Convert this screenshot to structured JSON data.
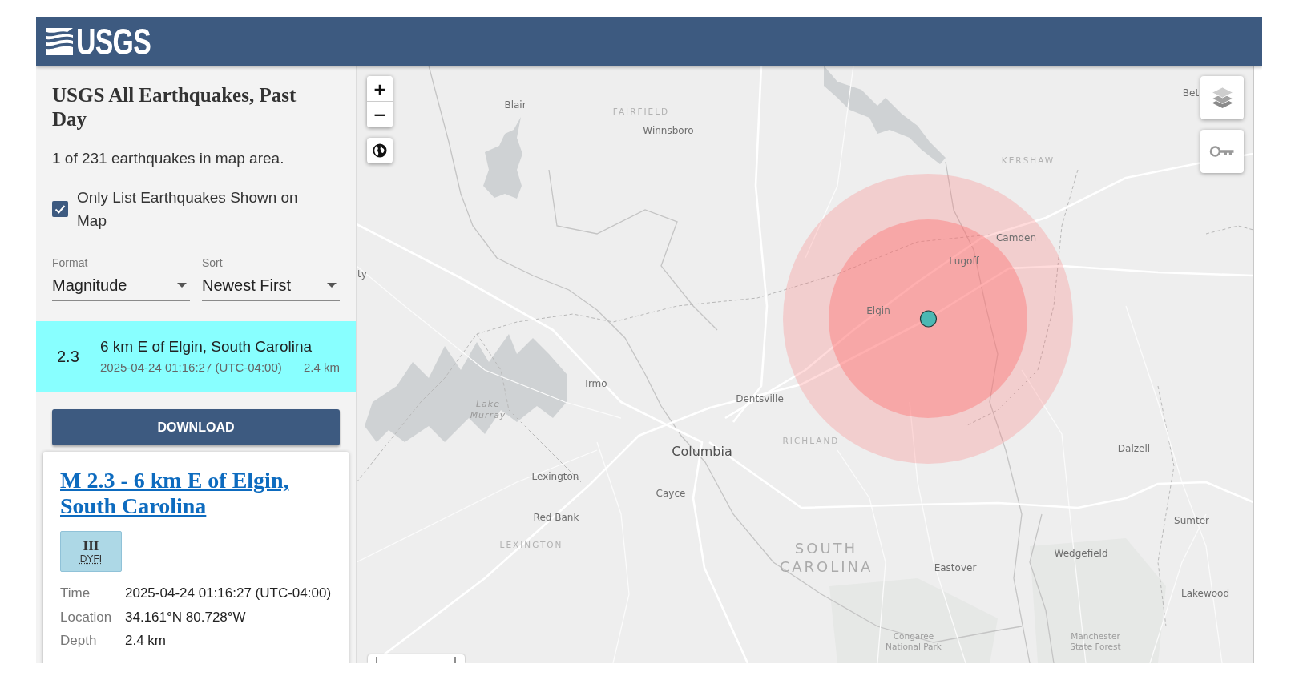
{
  "header": {
    "logo_text": "USGS"
  },
  "sidebar": {
    "title": "USGS All Earthquakes, Past Day",
    "count_text": "1 of 231 earthquakes in map area.",
    "filter_checkbox": {
      "label": "Only List Earthquakes Shown on Map",
      "checked": true
    },
    "selects": [
      {
        "label": "Format",
        "value": "Magnitude"
      },
      {
        "label": "Sort",
        "value": "Newest First"
      }
    ],
    "earthquakes": [
      {
        "magnitude": "2.3",
        "place": "6 km E of Elgin, South Carolina",
        "time": "2025-04-24 01:16:27 (UTC-04:00)",
        "depth": "2.4 km",
        "selected": true
      }
    ],
    "download_button": "DOWNLOAD",
    "detail_card": {
      "title": "M 2.3 - 6 km E of Elgin, South Carolina",
      "dyfi": {
        "intensity": "III",
        "label": "DYFI"
      },
      "rows": [
        {
          "label": "Time",
          "value": "2025-04-24 01:16:27 (UTC-04:00)"
        },
        {
          "label": "Location",
          "value": "34.161°N 80.728°W"
        },
        {
          "label": "Depth",
          "value": "2.4 km"
        }
      ]
    }
  },
  "map": {
    "zoom_in": "+",
    "zoom_out": "−",
    "labels": [
      {
        "text": "Blair",
        "kind": "city"
      },
      {
        "text": "FAIRFIELD",
        "kind": "county"
      },
      {
        "text": "Winnsboro",
        "kind": "city"
      },
      {
        "text": "Bet",
        "kind": "city"
      },
      {
        "text": "KERSHAW",
        "kind": "county"
      },
      {
        "text": "Camden",
        "kind": "city"
      },
      {
        "text": "Lugoff",
        "kind": "city"
      },
      {
        "text": "ty",
        "kind": "city"
      },
      {
        "text": "Elgin",
        "kind": "city"
      },
      {
        "text": "Irmo",
        "kind": "city"
      },
      {
        "text": "Dentsville",
        "kind": "city"
      },
      {
        "text": "Lake Murray",
        "kind": "water"
      },
      {
        "text": "RICHLAND",
        "kind": "county"
      },
      {
        "text": "Columbia",
        "kind": "major_city"
      },
      {
        "text": "Dalzell",
        "kind": "city"
      },
      {
        "text": "Lexington",
        "kind": "city"
      },
      {
        "text": "Cayce",
        "kind": "city"
      },
      {
        "text": "Red Bank",
        "kind": "city"
      },
      {
        "text": "Sumter",
        "kind": "city"
      },
      {
        "text": "LEXINGTON",
        "kind": "county"
      },
      {
        "text": "SOUTH CAROLINA",
        "kind": "state"
      },
      {
        "text": "Wedgefield",
        "kind": "city"
      },
      {
        "text": "Eastover",
        "kind": "city"
      },
      {
        "text": "Lakewood",
        "kind": "city"
      },
      {
        "text": "Congaree National Park",
        "kind": "park"
      },
      {
        "text": "Manchester State Forest",
        "kind": "park"
      }
    ]
  }
}
